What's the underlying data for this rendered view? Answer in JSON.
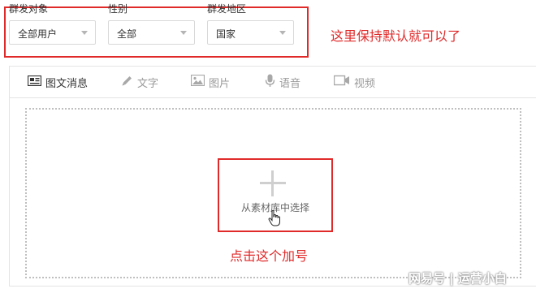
{
  "filters": [
    {
      "label": "群发对象",
      "value": "全部用户"
    },
    {
      "label": "性别",
      "value": "全部"
    },
    {
      "label": "群发地区",
      "value": "国家"
    }
  ],
  "annotations": {
    "filters_note": "这里保持默认就可以了",
    "plus_note": "点击这个加号"
  },
  "tabs": [
    {
      "label": "图文消息",
      "icon": "news-icon",
      "active": true
    },
    {
      "label": "文字",
      "icon": "pencil-icon",
      "active": false
    },
    {
      "label": "图片",
      "icon": "image-icon",
      "active": false
    },
    {
      "label": "语音",
      "icon": "microphone-icon",
      "active": false
    },
    {
      "label": "视频",
      "icon": "video-icon",
      "active": false
    }
  ],
  "upload": {
    "label": "从素材库中选择",
    "icon": "plus-icon"
  },
  "watermark": "网易号 | 运营小白",
  "colors": {
    "annotation_red": "#e02a2a",
    "active_tab": "#333333",
    "inactive_tab": "#9a9a9a"
  }
}
